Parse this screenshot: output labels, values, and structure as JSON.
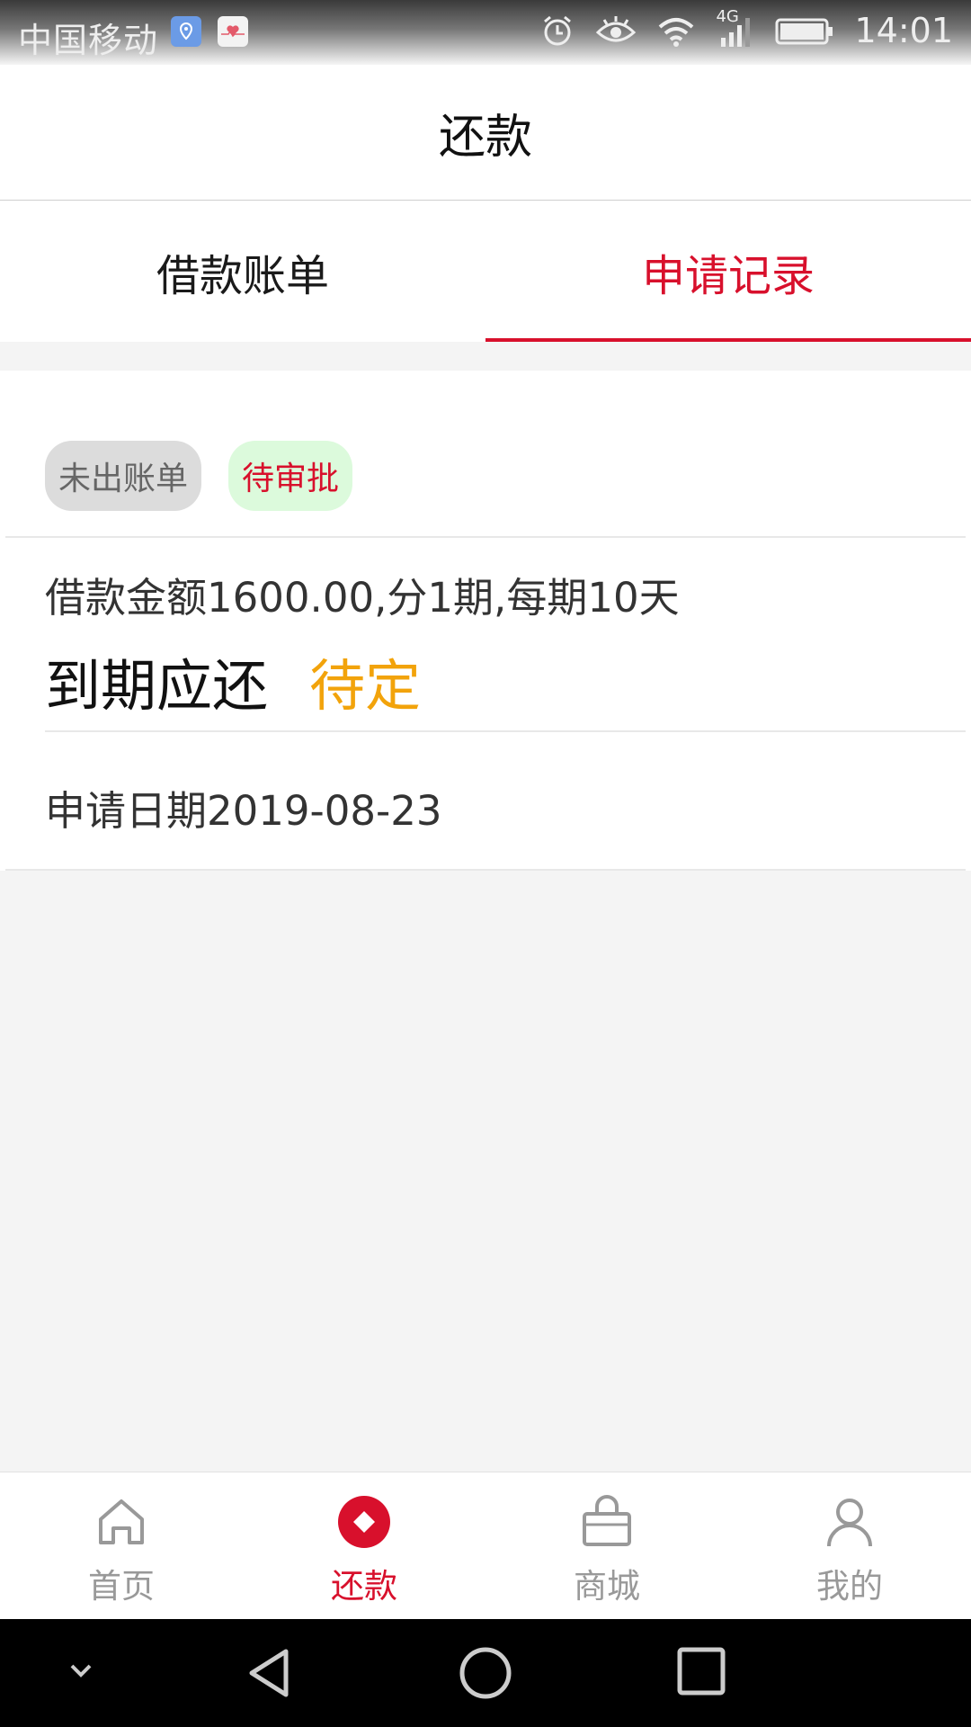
{
  "status_bar": {
    "carrier": "中国移动",
    "network": "4G",
    "time": "14:01"
  },
  "header": {
    "title": "还款"
  },
  "tabs": [
    {
      "label": "借款账单",
      "active": false
    },
    {
      "label": "申请记录",
      "active": true
    }
  ],
  "record": {
    "badges": [
      "未出账单",
      "待审批"
    ],
    "loan_info": "借款金额1600.00,分1期,每期10天",
    "due_label": "到期应还",
    "due_value": "待定",
    "apply_date": "申请日期2019-08-23"
  },
  "bottom_nav": [
    {
      "label": "首页",
      "icon": "home-icon"
    },
    {
      "label": "还款",
      "icon": "repay-icon",
      "active": true
    },
    {
      "label": "商城",
      "icon": "bag-icon"
    },
    {
      "label": "我的",
      "icon": "user-icon"
    }
  ],
  "colors": {
    "accent": "#d8102c",
    "pending": "#f2a30b",
    "badge_green_bg": "#dcfadc",
    "badge_gray_bg": "#dcdcdc"
  }
}
